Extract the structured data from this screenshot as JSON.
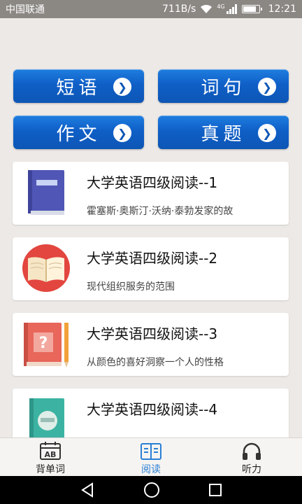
{
  "status_bar": {
    "carrier": "中国联通",
    "speed": "711B/s",
    "network": "4G",
    "time": "12:21"
  },
  "categories": [
    {
      "label": "短语",
      "icon": "chevron-right-icon"
    },
    {
      "label": "词句",
      "icon": "chevron-right-icon"
    },
    {
      "label": "作文",
      "icon": "chevron-right-icon"
    },
    {
      "label": "真题",
      "icon": "chevron-right-icon"
    }
  ],
  "articles": [
    {
      "title": "大学英语四级阅读--1",
      "desc": "霍塞斯·奥斯汀·沃纳·泰勃发家的故",
      "icon": "blue-book-icon"
    },
    {
      "title": "大学英语四级阅读--2",
      "desc": "现代组织服务的范围",
      "icon": "open-book-icon"
    },
    {
      "title": "大学英语四级阅读--3",
      "desc": "从颜色的喜好洞察一个人的性格",
      "icon": "question-book-icon"
    },
    {
      "title": "大学英语四级阅读--4",
      "desc": "",
      "icon": "green-book-icon"
    }
  ],
  "tabs": [
    {
      "label": "背单词",
      "icon": "calendar-ab-icon",
      "active": false
    },
    {
      "label": "阅读",
      "icon": "book-reading-icon",
      "active": true
    },
    {
      "label": "听力",
      "icon": "headphones-icon",
      "active": false
    }
  ],
  "colors": {
    "accent": "#2a7fd4",
    "button_blue": "#0f5fc7",
    "background": "#ece9e6"
  }
}
